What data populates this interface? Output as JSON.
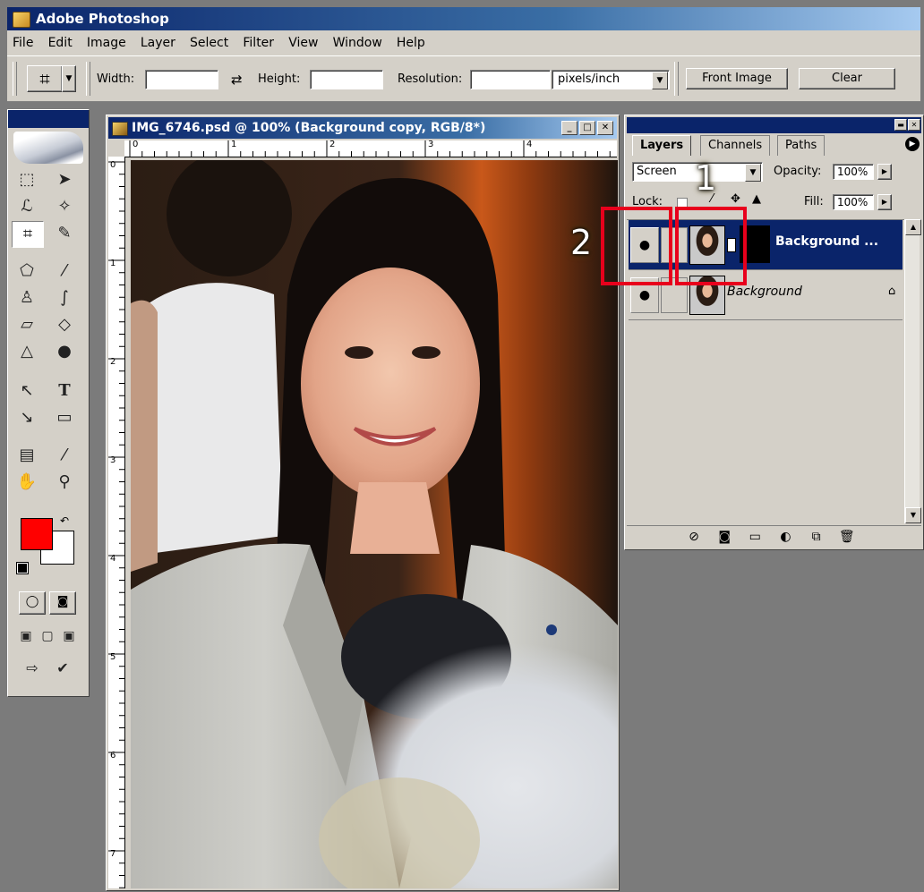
{
  "app": {
    "title": "Adobe Photoshop"
  },
  "menu": [
    "File",
    "Edit",
    "Image",
    "Layer",
    "Select",
    "Filter",
    "View",
    "Window",
    "Help"
  ],
  "options": {
    "width_label": "Width:",
    "height_label": "Height:",
    "resolution_label": "Resolution:",
    "units": "pixels/inch",
    "front_image": "Front Image",
    "clear": "Clear",
    "width_value": "",
    "height_value": "",
    "resolution_value": ""
  },
  "colors": {
    "foreground": "#ff0000",
    "background": "#ffffff",
    "annotation": "#e8001c",
    "titlebar": "#0a246a"
  },
  "document": {
    "title": "IMG_6746.psd @ 100% (Background copy, RGB/8*)",
    "ruler_h": [
      "0",
      "1",
      "2",
      "3",
      "4"
    ],
    "ruler_v": [
      "0",
      "1",
      "2",
      "3",
      "4",
      "5",
      "6",
      "7"
    ]
  },
  "layers": {
    "tabs": [
      "Layers",
      "Channels",
      "Paths"
    ],
    "blend_mode": "Screen",
    "opacity_label": "Opacity:",
    "opacity": "100%",
    "lock_label": "Lock:",
    "fill_label": "Fill:",
    "fill": "100%",
    "items": [
      {
        "name": "Background ...",
        "selected": true
      },
      {
        "name": "Background",
        "selected": false,
        "locked": true
      }
    ]
  },
  "annotations": [
    "1",
    "2"
  ],
  "icons": [
    "photoshop-icon",
    "crop-icon",
    "marquee-icon",
    "move-icon",
    "lasso-icon",
    "magic-wand-icon",
    "slice-icon",
    "healing-icon",
    "brush-icon",
    "stamp-icon",
    "history-brush-icon",
    "eraser-icon",
    "bucket-icon",
    "blur-icon",
    "dodge-icon",
    "path-select-icon",
    "type-icon",
    "pen-icon",
    "shape-icon",
    "notes-icon",
    "eyedropper-icon",
    "hand-icon",
    "zoom-icon",
    "eye-icon",
    "lock-icon",
    "trash-icon"
  ]
}
